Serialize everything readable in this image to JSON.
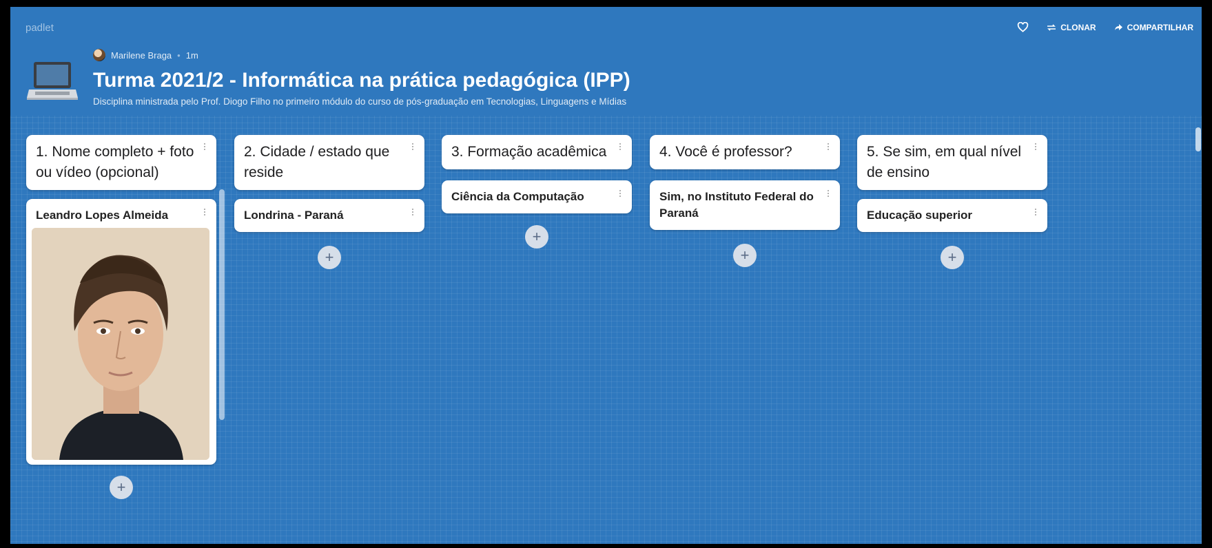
{
  "header": {
    "brand": "padlet",
    "clone_label": "CLONAR",
    "share_label": "COMPARTILHAR",
    "author": "Marilene Braga",
    "time_ago": "1m",
    "title": "Turma 2021/2 - Informática na prática pedagógica (IPP)",
    "subtitle": "Disciplina ministrada pelo Prof. Diogo Filho no primeiro módulo do curso de pós-graduação em Tecnologias, Linguagens e Mídias"
  },
  "columns": [
    {
      "title": "1. Nome completo + foto ou vídeo (opcional)",
      "posts": [
        "Leandro Lopes Almeida"
      ],
      "post_has_photo": true
    },
    {
      "title": "2. Cidade / estado que reside",
      "posts": [
        "Londrina - Paraná"
      ]
    },
    {
      "title": "3. Formação acadêmica",
      "posts": [
        "Ciência da Computação"
      ]
    },
    {
      "title": "4. Você é professor?",
      "posts": [
        "Sim, no Instituto Federal do Paraná"
      ]
    },
    {
      "title": "5. Se sim, em qual nível de ensino",
      "posts": [
        "Educação superior"
      ]
    }
  ],
  "icons": {
    "heart": "heart-icon",
    "clone": "clone-icon",
    "share": "share-icon",
    "laptop": "laptop-icon",
    "add": "plus-icon"
  },
  "colors": {
    "board": "#2f78be",
    "card": "#ffffff"
  }
}
